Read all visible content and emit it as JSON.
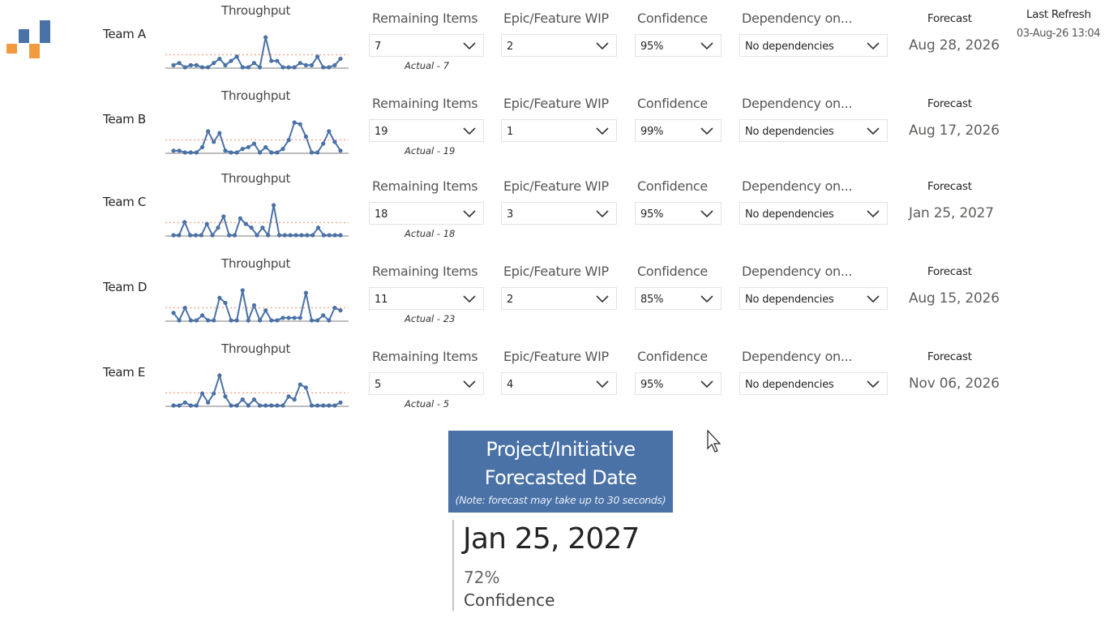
{
  "header": {
    "last_refresh_label": "Last Refresh",
    "last_refresh_value": "03-Aug-26 13:04"
  },
  "labels": {
    "throughput": "Throughput",
    "remaining_items": "Remaining Items",
    "epic_wip": "Epic/Feature WIP",
    "confidence": "Confidence",
    "dependency": "Dependency on...",
    "forecast": "Forecast"
  },
  "teams": [
    {
      "name": "Team A",
      "remaining": "7",
      "actual": "Actual - 7",
      "wip": "2",
      "confidence": "95%",
      "dependency": "No dependencies",
      "forecast": "Aug 28, 2026",
      "throughput": [
        1,
        2,
        0,
        1,
        1,
        0,
        0,
        2,
        4,
        1,
        3,
        5,
        0,
        0,
        2,
        0,
        14,
        3,
        3,
        0,
        0,
        0,
        2,
        1,
        1,
        5,
        0,
        0,
        1,
        4
      ]
    },
    {
      "name": "Team B",
      "remaining": "19",
      "actual": "Actual - 19",
      "wip": "1",
      "confidence": "99%",
      "dependency": "No dependencies",
      "forecast": "Aug 17, 2026",
      "throughput": [
        1,
        1,
        0,
        0,
        0,
        3,
        12,
        6,
        11,
        1,
        0,
        0,
        2,
        3,
        5,
        0,
        3,
        0,
        0,
        2,
        7,
        17,
        16,
        9,
        0,
        0,
        5,
        12,
        6,
        1
      ]
    },
    {
      "name": "Team C",
      "remaining": "18",
      "actual": "Actual - 18",
      "wip": "3",
      "confidence": "95%",
      "dependency": "No dependencies",
      "forecast": "Jan 25, 2027",
      "throughput": [
        0,
        0,
        7,
        0,
        0,
        0,
        6,
        0,
        4,
        10,
        0,
        0,
        9,
        6,
        4,
        0,
        4,
        0,
        16,
        0,
        0,
        0,
        0,
        0,
        0,
        0,
        4,
        0,
        0,
        0,
        0
      ]
    },
    {
      "name": "Team D",
      "remaining": "11",
      "actual": "Actual - 23",
      "wip": "2",
      "confidence": "85%",
      "dependency": "No dependencies",
      "forecast": "Aug 15, 2026",
      "throughput": [
        3,
        0,
        5,
        0,
        0,
        2,
        0,
        0,
        9,
        7,
        0,
        0,
        12,
        0,
        6,
        0,
        4,
        0,
        0,
        1,
        1,
        1,
        1,
        11,
        0,
        0,
        2,
        0,
        5,
        4
      ]
    },
    {
      "name": "Team E",
      "remaining": "5",
      "actual": "Actual - 5",
      "wip": "4",
      "confidence": "95%",
      "dependency": "No dependencies",
      "forecast": "Nov 06, 2026",
      "throughput": [
        0,
        0,
        1,
        0,
        0,
        4,
        1,
        4,
        10,
        3,
        0,
        0,
        2,
        0,
        2,
        0,
        0,
        0,
        0,
        0,
        3,
        2,
        7,
        6,
        0,
        0,
        0,
        0,
        0,
        1
      ]
    }
  ],
  "project": {
    "title_line1": "Project/Initiative",
    "title_line2": "Forecasted Date",
    "note": "(Note: forecast may take up to 30 seconds)",
    "date": "Jan 25, 2027",
    "confidence_pct": "72%",
    "confidence_label": "Confidence"
  },
  "colors": {
    "sparkline": "#4a72a7",
    "reference_line": "#f4a582",
    "baseline": "#bdbdbd",
    "logo_blue": "#4a72a7",
    "logo_orange": "#f29a3f"
  }
}
